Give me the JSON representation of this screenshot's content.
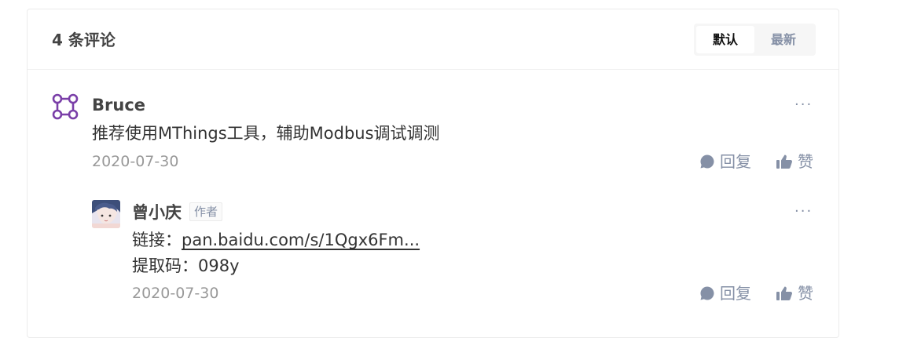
{
  "header": {
    "title": "4 条评论",
    "sort_default": "默认",
    "sort_latest": "最新"
  },
  "comments": [
    {
      "author": "Bruce",
      "content": "推荐使用MThings工具，辅助Modbus调试调测",
      "date": "2020-07-30",
      "reply": "回复",
      "like": "赞",
      "more": "···"
    },
    {
      "author": "曾小庆",
      "badge": "作者",
      "link_label": "链接：",
      "link_text": "pan.baidu.com/s/1Qgx6Fm...",
      "code_line": "提取码：098y",
      "date": "2020-07-30",
      "reply": "回复",
      "like": "赞",
      "more": "···"
    }
  ],
  "colors": {
    "muted": "#8590a6",
    "date": "#999999",
    "avatar_purple": "#7a3fa8"
  },
  "icons": {
    "avatar_1": "four-rings-logo",
    "avatar_2": "anime-avatar",
    "reply": "speech-bubble-icon",
    "like": "thumbs-up-icon"
  }
}
